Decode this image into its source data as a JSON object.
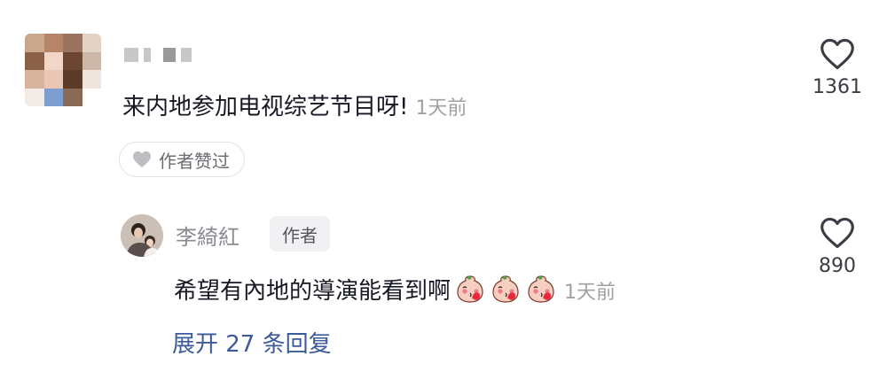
{
  "comment": {
    "text": "来内地参加电视综艺节目呀!",
    "time": "1天前",
    "likes": "1361",
    "author_liked_label": "作者赞过"
  },
  "reply": {
    "author_name": "李綺紅",
    "author_tag": "作者",
    "text": "希望有內地的導演能看到啊",
    "emoji_icons": [
      "blushing-face-emoji",
      "blushing-face-emoji",
      "blushing-face-emoji"
    ],
    "time": "1天前",
    "likes": "890"
  },
  "expand_label": "展开 27 条回复",
  "colors": {
    "text": "#161823",
    "muted": "#a0a0a5",
    "link": "#3d5a9a"
  }
}
